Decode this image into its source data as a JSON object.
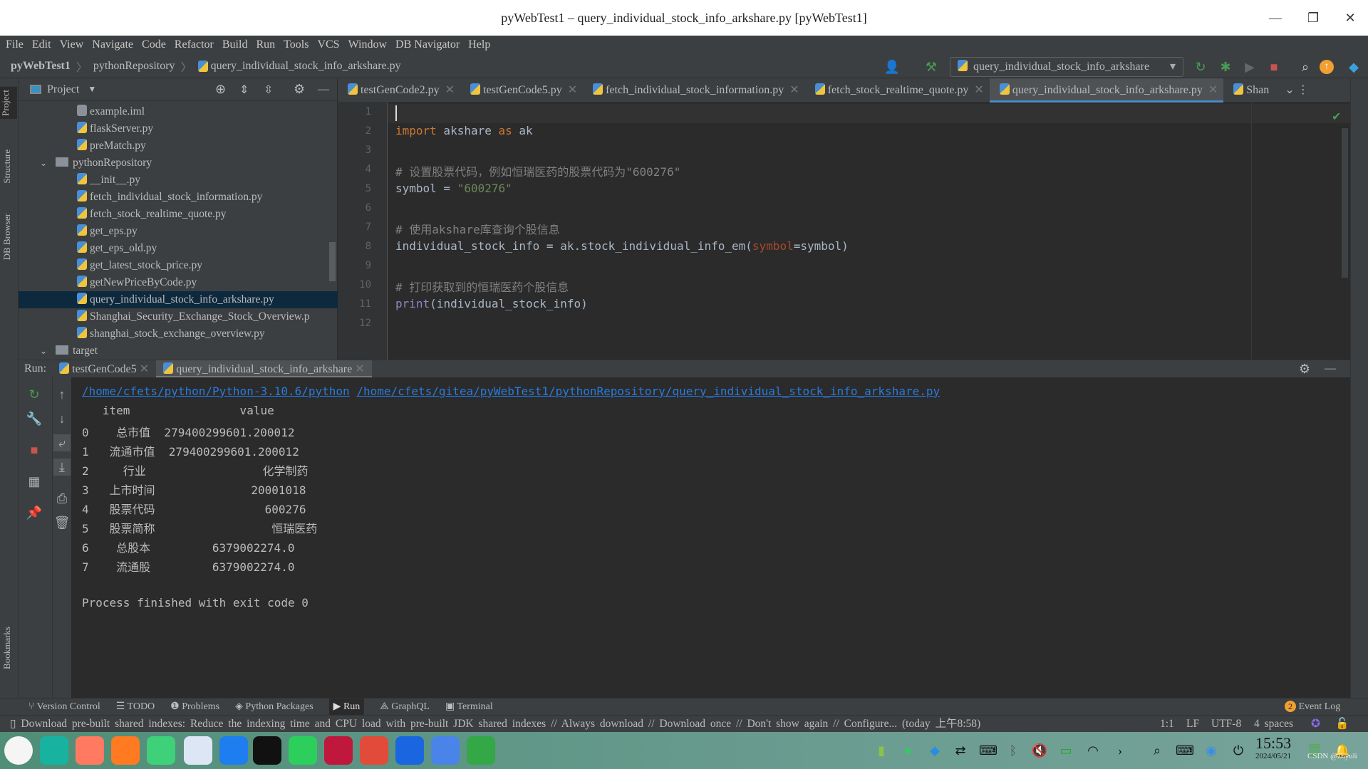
{
  "window": {
    "title": "pyWebTest1 – query_individual_stock_info_arkshare.py [pyWebTest1]"
  },
  "menu": [
    "File",
    "Edit",
    "View",
    "Navigate",
    "Code",
    "Refactor",
    "Build",
    "Run",
    "Tools",
    "VCS",
    "Window",
    "DB Navigator",
    "Help"
  ],
  "breadcrumb": [
    "pyWebTest1",
    "pythonRepository",
    "query_individual_stock_info_arkshare.py"
  ],
  "run_config": "query_individual_stock_info_arkshare",
  "side_tabs": {
    "left": [
      "Project",
      "Structure",
      "DB Browser",
      "Bookmarks"
    ]
  },
  "project": {
    "title": "Project",
    "tree": [
      {
        "label": "example.iml",
        "type": "file"
      },
      {
        "label": "flaskServer.py",
        "type": "py"
      },
      {
        "label": "preMatch.py",
        "type": "py"
      },
      {
        "label": "pythonRepository",
        "type": "folder"
      },
      {
        "label": "__init__.py",
        "type": "py"
      },
      {
        "label": "fetch_individual_stock_information.py",
        "type": "py"
      },
      {
        "label": "fetch_stock_realtime_quote.py",
        "type": "py"
      },
      {
        "label": "get_eps.py",
        "type": "py"
      },
      {
        "label": "get_eps_old.py",
        "type": "py"
      },
      {
        "label": "get_latest_stock_price.py",
        "type": "py"
      },
      {
        "label": "getNewPriceByCode.py",
        "type": "py"
      },
      {
        "label": "query_individual_stock_info_arkshare.py",
        "type": "py",
        "selected": true
      },
      {
        "label": "Shanghai_Security_Exchange_Stock_Overview.p",
        "type": "py"
      },
      {
        "label": "shanghai_stock_exchange_overview.py",
        "type": "py"
      },
      {
        "label": "target",
        "type": "folder"
      }
    ]
  },
  "editor_tabs": [
    {
      "label": "testGenCode2.py"
    },
    {
      "label": "testGenCode5.py"
    },
    {
      "label": "fetch_individual_stock_information.py"
    },
    {
      "label": "fetch_stock_realtime_quote.py"
    },
    {
      "label": "query_individual_stock_info_arkshare.py",
      "active": true
    },
    {
      "label": "Shan"
    }
  ],
  "code": {
    "line_numbers": [
      "1",
      "2",
      "3",
      "4",
      "5",
      "6",
      "7",
      "8",
      "9",
      "10",
      "11",
      "12"
    ],
    "l2": {
      "kw1": "import",
      "mid": " akshare ",
      "kw2": "as",
      "end": " ak"
    },
    "l4": "# 设置股票代码，例如恒瑞医药的股票代码为\"600276\"",
    "l5": {
      "a": "symbol = ",
      "s": "\"600276\""
    },
    "l7": "# 使用akshare库查询个股信息",
    "l8": {
      "a": "individual_stock_info = ak.stock_individual_info_em(",
      "p": "symbol",
      "b": "=symbol)"
    },
    "l10": "# 打印获取到的恒瑞医药个股信息",
    "l11": {
      "f": "print",
      "a": "(individual_stock_info)"
    }
  },
  "run": {
    "label": "Run:",
    "tabs": [
      {
        "label": "testGenCode5"
      },
      {
        "label": "query_individual_stock_info_arkshare",
        "active": true
      }
    ],
    "cmd_interpreter": "/home/cfets/python/Python-3.10.6/python",
    "cmd_script": "/home/cfets/gitea/pyWebTest1/pythonRepository/query_individual_stock_info_arkshare.py",
    "header": "   item                value",
    "rows": [
      "0    总市值  279400299601.200012",
      "1   流通市值  279400299601.200012",
      "2     行业                 化学制药",
      "3   上市时间              20001018",
      "4   股票代码                600276",
      "5   股票简称                 恒瑞医药",
      "6    总股本         6379002274.0",
      "7    流通股         6379002274.0"
    ],
    "exit": "Process finished with exit code 0"
  },
  "tool_windows": [
    "Version Control",
    "TODO",
    "Problems",
    "Python Packages",
    "Run",
    "GraphQL",
    "Terminal"
  ],
  "event_log": {
    "count": "2",
    "label": "Event Log"
  },
  "status": {
    "message": "Download pre-built shared indexes: Reduce the indexing time and CPU load with pre-built JDK shared indexes // Always download // Download once // Don't show again // Configure... (today 上午8:58)",
    "position": "1:1",
    "line_sep": "LF",
    "encoding": "UTF-8",
    "indent": "4 spaces"
  },
  "taskbar": {
    "time": "15:53",
    "date": "2024/05/21",
    "watermark": "CSDN @zhyuli"
  }
}
